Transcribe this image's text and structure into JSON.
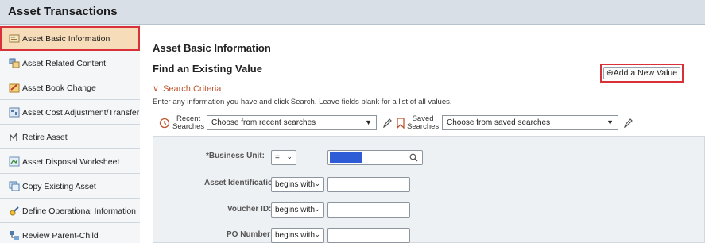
{
  "header": {
    "title": "Asset Transactions"
  },
  "sidebar": {
    "items": [
      {
        "label": "Asset Basic Information",
        "icon": "asset-basic-icon",
        "active": true
      },
      {
        "label": "Asset Related Content",
        "icon": "related-content-icon"
      },
      {
        "label": "Asset Book Change",
        "icon": "book-change-icon"
      },
      {
        "label": "Asset Cost Adjustment/Transfer",
        "icon": "cost-adjustment-icon"
      },
      {
        "label": "Retire Asset",
        "icon": "retire-icon"
      },
      {
        "label": "Asset Disposal Worksheet",
        "icon": "disposal-worksheet-icon"
      },
      {
        "label": "Copy Existing Asset",
        "icon": "copy-asset-icon"
      },
      {
        "label": "Define Operational Information",
        "icon": "operational-info-icon"
      },
      {
        "label": "Review Parent-Child",
        "icon": "parent-child-icon"
      }
    ]
  },
  "main": {
    "page_title": "Asset Basic Information",
    "section_title": "Find an Existing Value",
    "add_button": "⊕Add a New Value",
    "criteria_label": "Search Criteria",
    "hint": "Enter any information you have and click Search. Leave fields blank for a list of all values.",
    "recent": {
      "label_line1": "Recent",
      "label_line2": "Searches",
      "placeholder": "Choose from recent searches"
    },
    "saved": {
      "label_line1": "Saved",
      "label_line2": "Searches",
      "placeholder": "Choose from saved searches"
    },
    "fields": [
      {
        "label": "*Business Unit:",
        "operator": "=",
        "value": ""
      },
      {
        "label": "Asset Identification:",
        "operator": "begins with",
        "value": ""
      },
      {
        "label": "Voucher ID:",
        "operator": "begins with",
        "value": ""
      },
      {
        "label": "PO Number:",
        "operator": "begins with",
        "value": ""
      }
    ]
  },
  "colors": {
    "accent_orange": "#c0562f",
    "highlight_red": "#d9313a",
    "active_bg": "#f7dcb9",
    "bu_fill": "#2e5bd6"
  }
}
